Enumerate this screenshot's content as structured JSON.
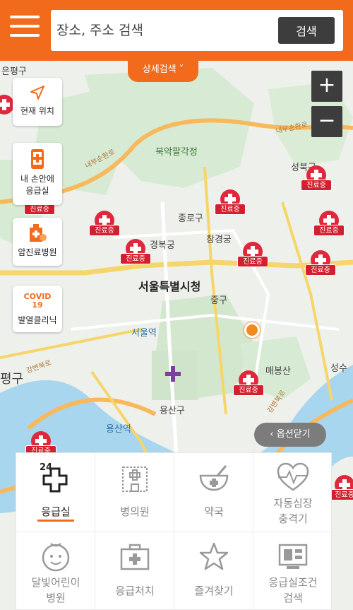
{
  "header": {
    "search_placeholder": "장소, 주소 검색",
    "search_button": "검색",
    "detail_search": "상세검색 ˅"
  },
  "map": {
    "labels": {
      "pyeonggu_top": "은평구",
      "bugak": "북악팔각정",
      "seongbuk": "성북구",
      "jongno": "종로구",
      "gyeongbok": "경복궁",
      "changgyeong": "창경궁",
      "city_hall": "서울특별시청",
      "jung": "중구",
      "seoul_station": "서울역",
      "maebong": "매봉산",
      "seongsu": "성수",
      "yongsan": "용산구",
      "yongsan_station": "용산역",
      "pyeonggu_left": "평구",
      "naebu1": "내부순환로",
      "naebu2": "내부순환로",
      "gangbyeon": "강변북로",
      "gangbyeon2": "강변북로"
    },
    "marker_tag": "진료중",
    "side_buttons": {
      "current_location": "현재 위치",
      "my_hand_line1": "내 손안에",
      "my_hand_line2": "응급실",
      "cancer": "암진료병원",
      "covid_line1": "COVID",
      "covid_line2": "19",
      "fever": "발열클리닉"
    },
    "close_options": "‹ 옵션닫기"
  },
  "menu": {
    "items": [
      {
        "label": "응급실",
        "icon": "emergency-24-icon",
        "active": true
      },
      {
        "label": "병의원",
        "icon": "hospital-icon",
        "active": false
      },
      {
        "label": "약국",
        "icon": "pharmacy-icon",
        "active": false
      },
      {
        "label1": "자동심장",
        "label2": "충격기",
        "icon": "aed-heart-icon",
        "active": false
      },
      {
        "label1": "달빛어린이",
        "label2": "병원",
        "icon": "child-face-icon",
        "active": false
      },
      {
        "label": "응급처치",
        "icon": "first-aid-kit-icon",
        "active": false
      },
      {
        "label": "즐겨찾기",
        "icon": "star-icon",
        "active": false
      },
      {
        "label1": "응급실조건",
        "label2": "검색",
        "icon": "monitor-search-icon",
        "active": false
      }
    ]
  },
  "colors": {
    "brand_orange": "#f26a1b",
    "marker_red": "#d31f2f",
    "dark_button": "#3d3d3d"
  }
}
